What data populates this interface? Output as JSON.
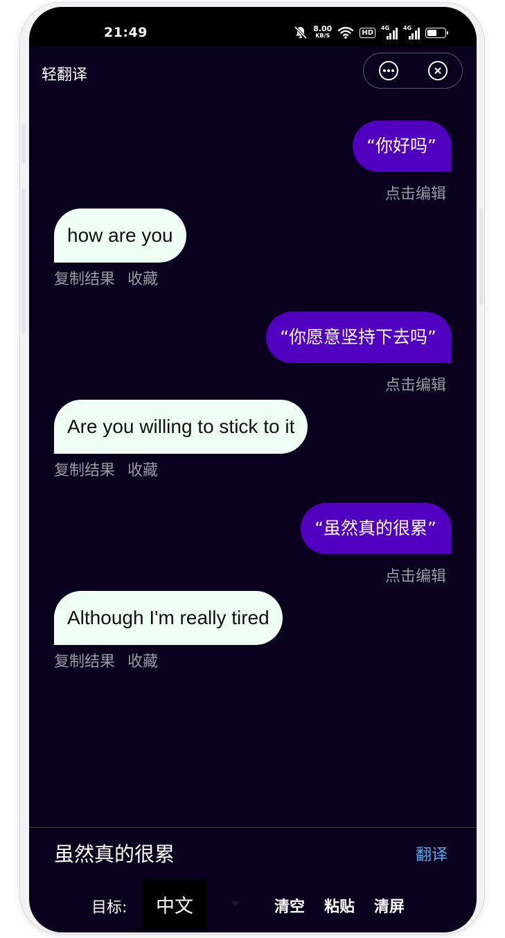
{
  "status_bar": {
    "time": "21:49",
    "net_speed_value": "8.00",
    "net_speed_unit": "KB/S",
    "hd_badge": "HD",
    "signal_1_label": "4G",
    "signal_2_label": "4G",
    "battery_level": 0.55
  },
  "header": {
    "title": "轻翻译",
    "more_icon": "more-dots-icon",
    "close_icon": "close-circle-icon"
  },
  "chat": {
    "messages": [
      {
        "source": "“你好吗”",
        "edit_label": "点击编辑",
        "translation": "how are you",
        "copy_label": "复制结果",
        "favorite_label": "收藏"
      },
      {
        "source": "“你愿意坚持下去吗”",
        "edit_label": "点击编辑",
        "translation": "Are you willing to stick to it",
        "copy_label": "复制结果",
        "favorite_label": "收藏"
      },
      {
        "source": "“虽然真的很累”",
        "edit_label": "点击编辑",
        "translation": "Although I'm really tired",
        "copy_label": "复制结果",
        "favorite_label": "收藏"
      }
    ]
  },
  "input": {
    "value": "虽然真的很累",
    "translate_label": "翻译"
  },
  "toolbar": {
    "target_label": "目标:",
    "target_language": "中文",
    "dropdown_icon": "chevron-down-icon",
    "clear_label": "清空",
    "paste_label": "粘贴",
    "clear_screen_label": "清屏"
  },
  "colors": {
    "background": "#08001d",
    "user_bubble": "#5200c0",
    "translation_bubble": "#effff6",
    "accent": "#5fa8ee",
    "muted_text": "#9a9aa2"
  }
}
